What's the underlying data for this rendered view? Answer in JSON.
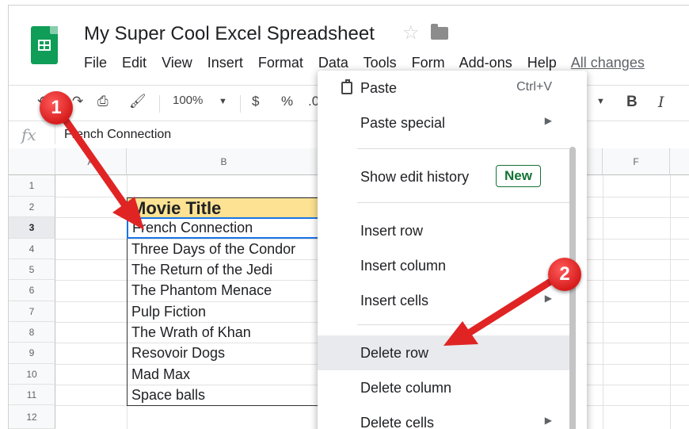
{
  "app": {
    "doc_title": "My Super Cool Excel Spreadsheet",
    "menu": [
      "File",
      "Edit",
      "View",
      "Insert",
      "Format",
      "Data",
      "Tools",
      "Form",
      "Add-ons",
      "Help"
    ],
    "changes_link": "All changes"
  },
  "toolbar": {
    "zoom": "100%",
    "currency": "$",
    "percent": "%",
    "decimal": ".0",
    "bold": "B",
    "italic": "I"
  },
  "formula_bar": {
    "fx": "fx",
    "value": "French Connection"
  },
  "grid": {
    "columns": [
      "A",
      "B",
      "F"
    ],
    "rows": [
      "1",
      "2",
      "3",
      "4",
      "5",
      "6",
      "7",
      "8",
      "9",
      "10",
      "11",
      "12"
    ],
    "header_cell": "Movie Title",
    "cells": [
      "French Connection",
      "Three Days of the Condor",
      "The Return of the Jedi",
      "The Phantom Menace",
      "Pulp Fiction",
      "The Wrath of Khan",
      "Resovoir Dogs",
      "Mad Max",
      "Space balls"
    ]
  },
  "context_menu": {
    "paste": "Paste",
    "paste_shortcut": "Ctrl+V",
    "paste_special": "Paste special",
    "show_edit_history": "Show edit history",
    "new_badge": "New",
    "insert_row": "Insert row",
    "insert_column": "Insert column",
    "insert_cells": "Insert cells",
    "delete_row": "Delete row",
    "delete_column": "Delete column",
    "delete_cells": "Delete cells"
  },
  "callouts": {
    "one": "1",
    "two": "2"
  },
  "colors": {
    "brand_green": "#0f9d58",
    "header_fill": "#fde293",
    "selection_blue": "#1a73e8",
    "callout_red": "#e02424"
  }
}
